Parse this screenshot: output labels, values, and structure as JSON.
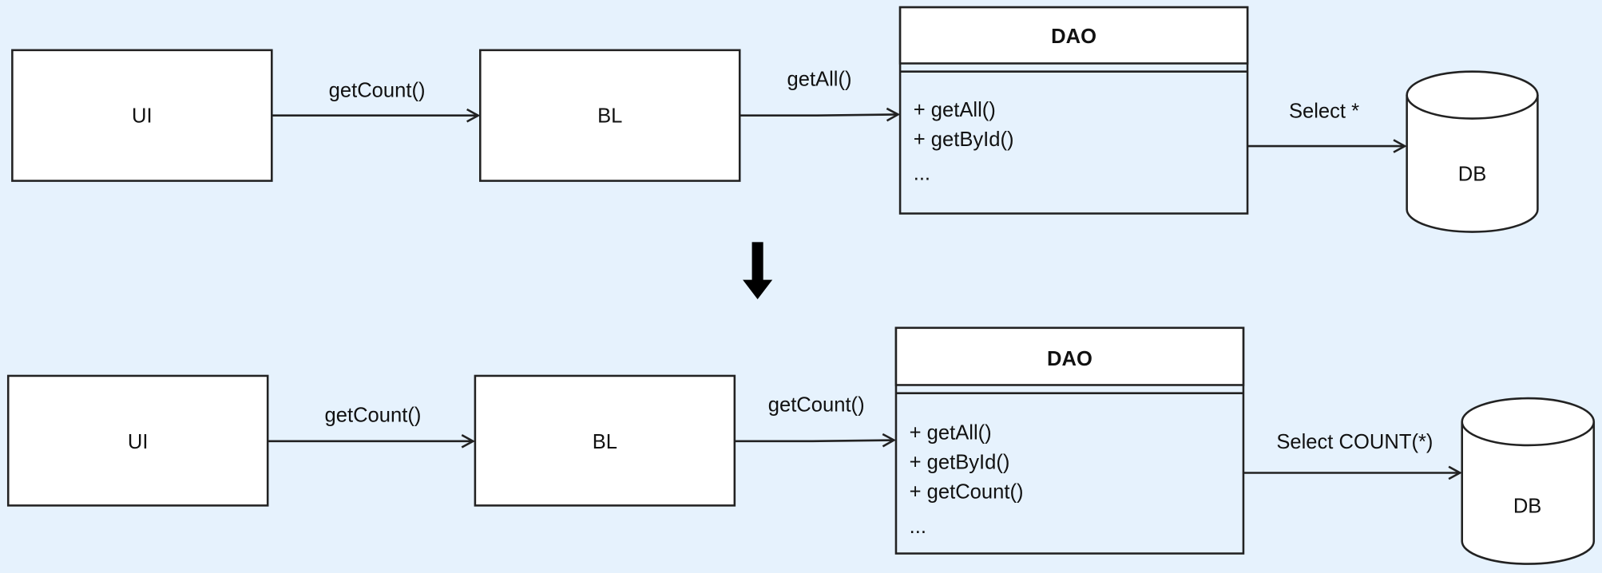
{
  "colors": {
    "background": "#e6f2fd",
    "box_fill": "#ffffff",
    "stroke": "#222222"
  },
  "before": {
    "ui": "UI",
    "bl": "BL",
    "ui_to_bl": "getCount()",
    "bl_to_dao": "getAll()",
    "dao": {
      "title": "DAO",
      "methods": [
        "+ getAll()",
        "+ getById()",
        "..."
      ]
    },
    "dao_to_db": "Select *",
    "db": "DB"
  },
  "transition_icon": "arrow-down-icon",
  "after": {
    "ui": "UI",
    "bl": "BL",
    "ui_to_bl": "getCount()",
    "bl_to_dao": "getCount()",
    "dao": {
      "title": "DAO",
      "methods": [
        "+ getAll()",
        "+ getById()",
        "+ getCount()",
        "..."
      ]
    },
    "dao_to_db": "Select COUNT(*)",
    "db": "DB"
  }
}
